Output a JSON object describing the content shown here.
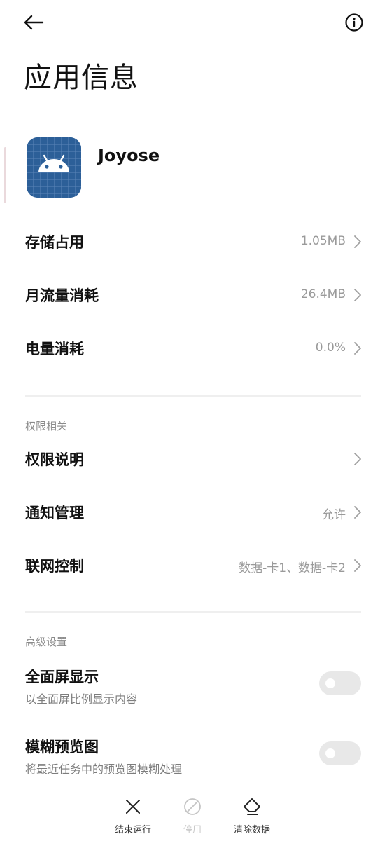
{
  "header": {
    "title": "应用信息"
  },
  "app": {
    "name": "Joyose"
  },
  "usage": [
    {
      "label": "存储占用",
      "value": "1.05MB"
    },
    {
      "label": "月流量消耗",
      "value": "26.4MB"
    },
    {
      "label": "电量消耗",
      "value": "0.0%"
    }
  ],
  "permissions": {
    "section_title": "权限相关",
    "items": [
      {
        "label": "权限说明",
        "value": ""
      },
      {
        "label": "通知管理",
        "value": "允许"
      },
      {
        "label": "联网控制",
        "value": "数据-卡1、数据-卡2"
      }
    ]
  },
  "advanced": {
    "section_title": "高级设置",
    "items": [
      {
        "label": "全面屏显示",
        "sub": "以全面屏比例显示内容",
        "enabled": false
      },
      {
        "label": "模糊预览图",
        "sub": "将最近任务中的预览图模糊处理",
        "enabled": false
      }
    ]
  },
  "actions": {
    "force_stop": "结束运行",
    "disable": "停用",
    "clear_data": "清除数据"
  },
  "colors": {
    "app_icon_bg": "#2c5f98",
    "muted_text": "#9a9a9a",
    "toggle_off": "#e8e8e8"
  }
}
